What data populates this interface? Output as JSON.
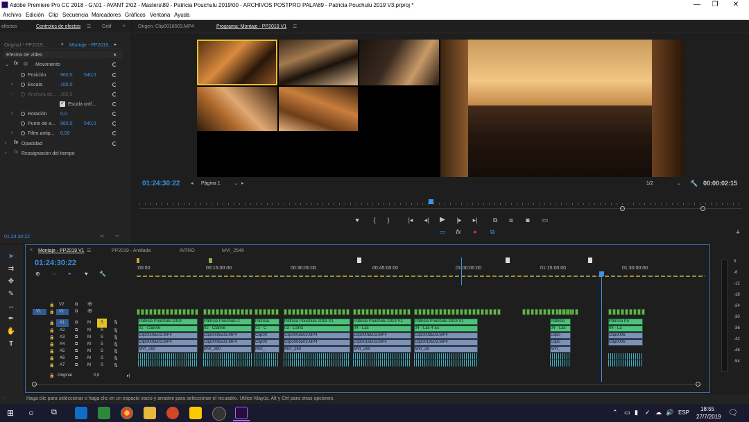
{
  "titlebar": {
    "title": "Adobe Premiere Pro CC 2018 - G:\\01 - AVANT 2\\02 - Masters\\89 - Patricia Pouchulu 2019\\00 - ARCHIVOS POSTPRO PALA\\89 - Patricia Pouchulu 2019 V3.prproj *",
    "minimize": "—",
    "maximize": "❐",
    "close": "✕"
  },
  "menu": [
    "Archivo",
    "Edición",
    "Clip",
    "Secuencia",
    "Marcadores",
    "Gráficos",
    "Ventana",
    "Ayuda"
  ],
  "effects_panel": {
    "tabs": [
      "efectos",
      "Controles de efectos",
      "Gráf"
    ],
    "source_clip": "Original * PP2019...",
    "sequence_clip": "Montaje - PP2019...",
    "section": "Efectos de vídeo",
    "movimiento": "Movimiento",
    "posicion": {
      "label": "Posición",
      "x": "960,0",
      "y": "540,0"
    },
    "escala": {
      "label": "Escala",
      "value": "100,0"
    },
    "anchura": {
      "label": "Anchura de...",
      "value": "100,0"
    },
    "escala_uniforme": "Escala unif...",
    "rotacion": {
      "label": "Rotación",
      "value": "0,0"
    },
    "punto_anclaje": {
      "label": "Punto de a...",
      "x": "960,0",
      "y": "540,0"
    },
    "filtro": {
      "label": "Filtro antip...",
      "value": "0,00"
    },
    "opacidad": "Opacidad",
    "reasignacion": "Reasignación del tiempo",
    "timecode": "01:24:30:22"
  },
  "source_monitor": {
    "tab": "Origen: Clip0016503.MP4"
  },
  "program_monitor": {
    "tab": "Programa: Montaje - PP2019 V1",
    "timecode": "01:24:30:22",
    "page": "Página 1",
    "resolution": "1/2",
    "duration": "00:00:02:15",
    "playhead_fraction": 0.48
  },
  "timeline": {
    "tabs": [
      "Montaje - PP2019 V1",
      "PP2019 - Anidada",
      "INTRO",
      "MVI_2546"
    ],
    "timecode": "01:24:30:22",
    "ruler": [
      ":00:00",
      "00:15:00:00",
      "00:30:00:00",
      "00:45:00:00",
      "01:00:00:00",
      "01:15:00:00",
      "01:30:00:00"
    ],
    "tracks_video": [
      "V2",
      "V1"
    ],
    "tracks_audio": [
      "A1",
      "A2",
      "A3",
      "A4",
      "A5",
      "A6",
      "A7"
    ],
    "original": "Original",
    "original_value": "0,0",
    "a1_clips": [
      "Patricia Pouchulu 2019",
      "Patricia Pouchulu 2",
      "Patricia",
      "Patricia Pouchulu 2019 V1",
      "Patricia Pouchulu 2019 V1",
      "Patricia Pouchulu 2019 V1",
      "Patricia",
      "Patricia Po"
    ],
    "a2_clips": [
      "02 - Clarine",
      "02 - Clarine",
      "03 - C",
      "03 - Conci",
      "04 - Las",
      "04 - Las 4 Es",
      "04 - Las",
      "04 - La"
    ],
    "a3_clips": [
      "Clip0006503.MP4",
      "Clip0006503.MP4",
      "Clip00",
      "Clip0008503.MP4",
      "Clip0008503.MP4",
      "Clip0008503.MP4",
      "Clip0",
      "Clip0006"
    ],
    "a4_clips": [
      "Clip0006503.MP4",
      "Clip0006503.MP4",
      "Clip00",
      "Clip0006503.MP4",
      "Clip0019503.MP4",
      "Clip0019503.MP4",
      "Clip0",
      "Clip0006"
    ],
    "a5_clips": [
      "MVI_260",
      "MVI_260",
      "MVI_",
      "MVI_260",
      "MVI_260",
      "MVI_26",
      "MVI_"
    ],
    "meter_scale": [
      "0",
      "-6",
      "-12",
      "-18",
      "-24",
      "-30",
      "-36",
      "-42",
      "-48",
      "-54"
    ]
  },
  "status": "Haga clic para seleccionar o haga clic en un espacio vacío y arrastre para seleccionar el recuadro. Utilice Mayús, Alt y Ctrl para otras opciones.",
  "taskbar": {
    "lang": "ESP",
    "time": "18:55",
    "date": "27/7/2019"
  }
}
